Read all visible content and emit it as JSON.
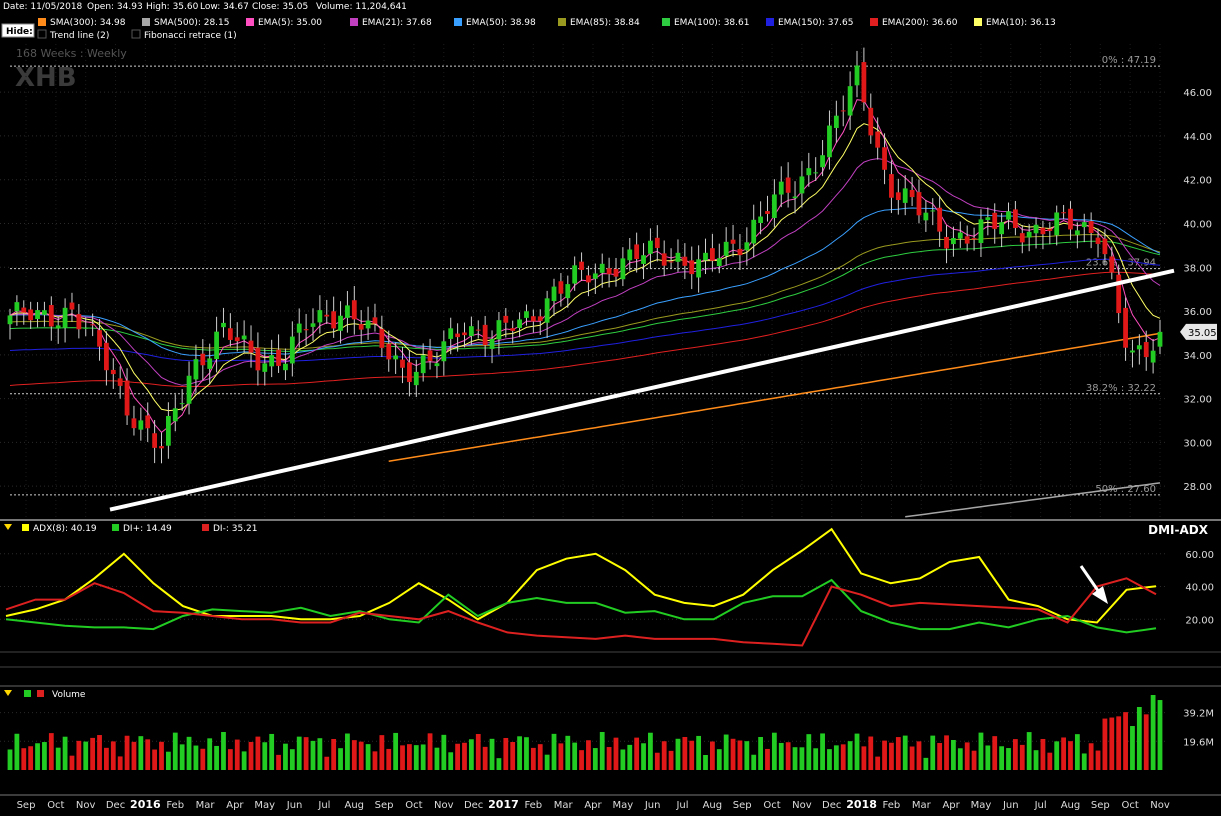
{
  "header": {
    "date": "Date: 11/05/2018",
    "open": "Open: 34.93",
    "high": "High: 35.60",
    "low": "Low: 34.67",
    "close": "Close: 35.05",
    "volume": "Volume: 11,204,641"
  },
  "toolbar": {
    "hide_label": "Hide:",
    "legend": [
      {
        "label": "SMA(300): 34.98",
        "color": "#ff8c1a"
      },
      {
        "label": "SMA(500): 28.15",
        "color": "#a6a6a6"
      },
      {
        "label": "EMA(5): 35.00",
        "color": "#ff4fc0"
      },
      {
        "label": "EMA(21): 37.68",
        "color": "#c040c0"
      },
      {
        "label": "EMA(50): 38.98",
        "color": "#3aa0ff"
      },
      {
        "label": "EMA(85): 38.84",
        "color": "#9a9a20"
      },
      {
        "label": "EMA(100): 38.61",
        "color": "#2ecc40"
      },
      {
        "label": "EMA(150): 37.65",
        "color": "#2020e0"
      },
      {
        "label": "EMA(200): 36.60",
        "color": "#e02020"
      },
      {
        "label": "EMA(10): 36.13",
        "color": "#ffff66"
      }
    ],
    "legend2": [
      {
        "label": "Trend line (2)",
        "color": "#000000"
      },
      {
        "label": "Fibonacci retrace (1)",
        "color": "#000000"
      }
    ]
  },
  "price_panel": {
    "period": "168 Weeks : Weekly",
    "ticker": "XHB",
    "last_price": "35.05",
    "fib_labels": [
      {
        "text": "0% : 47.19",
        "value": 47.19
      },
      {
        "text": "23.6% : 37.94",
        "value": 37.94
      },
      {
        "text": "38.2% : 32.22",
        "value": 32.22
      },
      {
        "text": "50% : 27.60",
        "value": 27.6
      }
    ]
  },
  "dmi_panel": {
    "title": "DMI-ADX",
    "legend": [
      {
        "label": "ADX(8): 40.19",
        "color": "#ffff00"
      },
      {
        "label": "DI+: 14.49",
        "color": "#22cc22"
      },
      {
        "label": "DI-: 35.21",
        "color": "#dd2020"
      }
    ]
  },
  "volume_panel": {
    "label": "Volume"
  },
  "x_axis_labels": [
    "Sep",
    "Oct",
    "Nov",
    "Dec",
    "2016",
    "Feb",
    "Mar",
    "Apr",
    "May",
    "Jun",
    "Jul",
    "Aug",
    "Sep",
    "Oct",
    "Nov",
    "Dec",
    "2017",
    "Feb",
    "Mar",
    "Apr",
    "May",
    "Jun",
    "Jul",
    "Aug",
    "Sep",
    "Oct",
    "Nov",
    "Dec",
    "2018",
    "Feb",
    "Mar",
    "Apr",
    "May",
    "Jun",
    "Jul",
    "Aug",
    "Sep",
    "Oct",
    "Nov"
  ],
  "chart_data": {
    "type": "candlestick",
    "ticker": "XHB",
    "interval": "Weekly",
    "price_ylim": [
      26.5,
      48.2
    ],
    "price_ticks": [
      28,
      30,
      32,
      34,
      36,
      38,
      40,
      42,
      44,
      46
    ],
    "close_anchors": [
      {
        "month": "Sep 2015",
        "close": 35.8
      },
      {
        "month": "Oct 2015",
        "close": 35.6
      },
      {
        "month": "Nov 2015",
        "close": 36.2
      },
      {
        "month": "Dec 2015",
        "close": 34.0
      },
      {
        "month": "Jan 2016",
        "close": 31.5
      },
      {
        "month": "Feb 2016",
        "close": 29.5
      },
      {
        "month": "Mar 2016",
        "close": 33.5
      },
      {
        "month": "Apr 2016",
        "close": 35.0
      },
      {
        "month": "May 2016",
        "close": 34.0
      },
      {
        "month": "Jun 2016",
        "close": 33.8
      },
      {
        "month": "Jul 2016",
        "close": 35.5
      },
      {
        "month": "Aug 2016",
        "close": 36.2
      },
      {
        "month": "Sep 2016",
        "close": 34.8
      },
      {
        "month": "Oct 2016",
        "close": 33.5
      },
      {
        "month": "Nov 2016",
        "close": 33.5
      },
      {
        "month": "Dec 2016",
        "close": 35.5
      },
      {
        "month": "Jan 2017",
        "close": 34.8
      },
      {
        "month": "Feb 2017",
        "close": 35.5
      },
      {
        "month": "Mar 2017",
        "close": 37.0
      },
      {
        "month": "Apr 2017",
        "close": 37.5
      },
      {
        "month": "May 2017",
        "close": 38.3
      },
      {
        "month": "Jun 2017",
        "close": 38.5
      },
      {
        "month": "Jul 2017",
        "close": 38.6
      },
      {
        "month": "Aug 2017",
        "close": 38.0
      },
      {
        "month": "Sep 2017",
        "close": 39.0
      },
      {
        "month": "Oct 2017",
        "close": 40.8
      },
      {
        "month": "Nov 2017",
        "close": 41.5
      },
      {
        "month": "Dec 2017",
        "close": 44.0
      },
      {
        "month": "Jan 2018",
        "close": 46.5
      },
      {
        "month": "Feb 2018",
        "close": 42.0
      },
      {
        "month": "Mar 2018",
        "close": 40.5
      },
      {
        "month": "Apr 2018",
        "close": 39.5
      },
      {
        "month": "May 2018",
        "close": 39.5
      },
      {
        "month": "Jun 2018",
        "close": 40.2
      },
      {
        "month": "Jul 2018",
        "close": 39.6
      },
      {
        "month": "Aug 2018",
        "close": 40.0
      },
      {
        "month": "Sep 2018",
        "close": 39.8
      },
      {
        "month": "Oct 2018",
        "close": 33.5
      },
      {
        "month": "Nov 2018",
        "close": 35.05
      }
    ],
    "trend_line": {
      "from": {
        "month": "Feb 2016",
        "value": 27.6
      },
      "to": {
        "month": "Nov 2018",
        "value": 37.7
      }
    },
    "fib_levels": [
      47.19,
      37.94,
      32.22,
      27.6
    ],
    "dmi_ylim": [
      0,
      80
    ],
    "dmi_ticks": [
      20,
      40,
      60
    ],
    "dmi_series": [
      {
        "name": "ADX(8)",
        "color": "#ffff00",
        "values": [
          22,
          26,
          32,
          45,
          60,
          42,
          28,
          22,
          22,
          22,
          20,
          20,
          22,
          30,
          42,
          32,
          20,
          30,
          50,
          57,
          60,
          50,
          35,
          30,
          28,
          35,
          50,
          62,
          75,
          48,
          42,
          45,
          55,
          58,
          32,
          28,
          20,
          18,
          38,
          40.19
        ]
      },
      {
        "name": "DI+",
        "color": "#22cc22",
        "values": [
          20,
          18,
          16,
          15,
          15,
          14,
          22,
          26,
          25,
          24,
          27,
          22,
          25,
          20,
          18,
          35,
          22,
          30,
          33,
          30,
          30,
          24,
          25,
          20,
          20,
          30,
          34,
          34,
          44,
          25,
          18,
          14,
          14,
          18,
          15,
          20,
          22,
          15,
          12,
          14.49
        ]
      },
      {
        "name": "DI-",
        "color": "#dd2020",
        "values": [
          26,
          32,
          32,
          42,
          36,
          25,
          24,
          22,
          20,
          20,
          18,
          18,
          24,
          22,
          20,
          25,
          18,
          12,
          10,
          9,
          8,
          10,
          8,
          8,
          8,
          6,
          5,
          4,
          40,
          35,
          28,
          30,
          29,
          28,
          27,
          26,
          18,
          40,
          45,
          35.21
        ]
      }
    ],
    "volume_ylim": [
      0,
      43
    ],
    "volume_ticks": [
      {
        "value": 19.6,
        "label": "19.6M"
      },
      {
        "value": 39.2,
        "label": "39.2M"
      }
    ]
  }
}
